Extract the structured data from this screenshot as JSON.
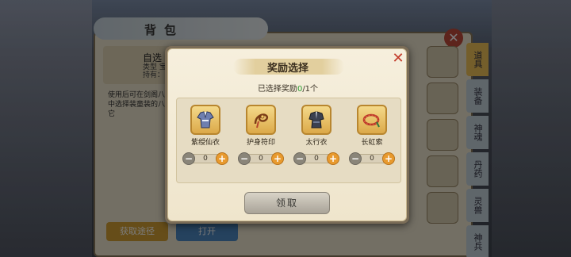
{
  "background": {
    "bag_title": "背包",
    "bag_close_icon": "close-icon",
    "item_name": "自选",
    "item_type": "类型 宝\n持有：",
    "item_desc": "使用后可在剑阁八个中选择装童装的八个它",
    "button_a": "获取途径",
    "button_b": "打开",
    "side_tabs": [
      "道具",
      "装备",
      "神魂",
      "丹药",
      "灵兽",
      "神兵"
    ]
  },
  "dialog": {
    "title": "奖励选择",
    "close_icon": "close-x-icon",
    "subtitle_prefix": "已选择奖励",
    "subtitle_count": "0",
    "subtitle_suffix": "/1个",
    "claim_label": "领取",
    "rewards": [
      {
        "name": "紫绶仙衣",
        "icon": "robe-icon",
        "count": "0"
      },
      {
        "name": "护身符印",
        "icon": "amulet-icon",
        "count": "0"
      },
      {
        "name": "太行衣",
        "icon": "armor-icon",
        "count": "0"
      },
      {
        "name": "长虹索",
        "icon": "rope-icon",
        "count": "0"
      }
    ],
    "minus_label": "−",
    "plus_label": "+"
  },
  "colors": {
    "accent_green": "#2e9b35",
    "close_red": "#c33b2a",
    "plus_orange": "#e89a2e"
  }
}
